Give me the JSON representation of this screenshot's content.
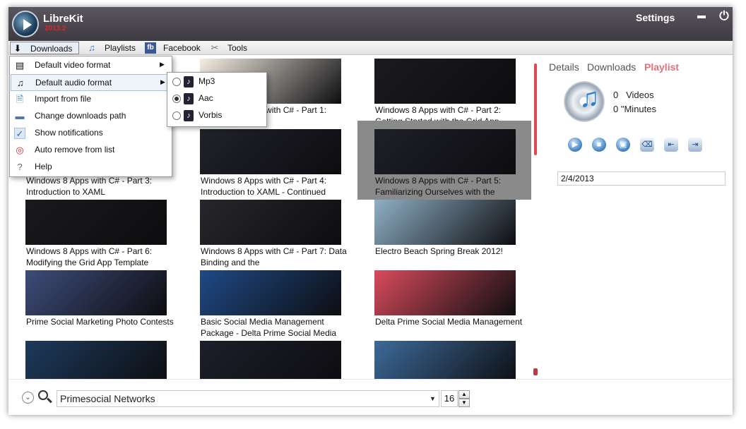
{
  "app": {
    "title": "LibreKit",
    "version": "2013.2"
  },
  "header": {
    "settings_label": "Settings",
    "minimize_icon": "minimize-icon",
    "power_icon": "power-icon"
  },
  "menubar": {
    "items": [
      {
        "label": "Downloads",
        "icon": "download-arrow-icon"
      },
      {
        "label": "Playlists",
        "icon": "music-note-icon"
      },
      {
        "label": "Facebook",
        "icon": "facebook-icon"
      },
      {
        "label": "Tools",
        "icon": "tools-icon"
      }
    ]
  },
  "downloads_menu": {
    "items": [
      {
        "label": "Default video format",
        "icon": "film-icon",
        "has_submenu": true
      },
      {
        "label": "Default audio format",
        "icon": "music-note-icon",
        "has_submenu": true
      },
      {
        "label": "Import from file",
        "icon": "file-import-icon"
      },
      {
        "label": "Change downloads path",
        "icon": "folder-icon"
      },
      {
        "label": "Show notifications",
        "icon": "checkmark-icon",
        "checked": true
      },
      {
        "label": "Auto remove from list",
        "icon": "lifebuoy-icon"
      },
      {
        "label": "Help",
        "icon": "help-icon"
      }
    ],
    "audio_submenu": [
      {
        "label": "Mp3",
        "selected": false
      },
      {
        "label": "Aac",
        "selected": true
      },
      {
        "label": "Vorbis",
        "selected": false
      }
    ]
  },
  "videos": [
    {
      "title": "",
      "thumb_color": "#e8d9c4"
    },
    {
      "title": "Windows 8 Apps with C# - Part 1: Introduction",
      "thumb_color": "#f4ede2"
    },
    {
      "title": "Windows 8 Apps with C# - Part 2: Getting Started with the Grid App",
      "thumb_color": "#1b1b1f"
    },
    {
      "title": "Windows 8 Apps with C# - Part 3: Introduction to XAML",
      "thumb_color": "#2b2d33"
    },
    {
      "title": "Windows 8 Apps with C# - Part 4: Introduction to XAML - Continued",
      "thumb_color": "#20222a"
    },
    {
      "title": "Windows 8 Apps with C# - Part 5: Familiarizing Ourselves with the",
      "thumb_color": "#1e2028"
    },
    {
      "title": "Windows 8 Apps with C# - Part 6: Modifying the Grid App Template",
      "thumb_color": "#1a1a1e"
    },
    {
      "title": "Windows 8 Apps with C# - Part 7: Data Binding and the",
      "thumb_color": "#26272c"
    },
    {
      "title": "Electro Beach Spring Break 2012!",
      "thumb_color": "#8fb0c6"
    },
    {
      "title": "Prime Social Marketing Photo Contests",
      "thumb_color": "#3d4c7a"
    },
    {
      "title": "Basic Social Media Management Package - Delta Prime Social Media",
      "thumb_color": "#1f4a86"
    },
    {
      "title": "Delta Prime Social Media Management",
      "thumb_color": "#d94b5c"
    },
    {
      "title": "",
      "thumb_color": "#1d3a5c"
    },
    {
      "title": "",
      "thumb_color": "#1c1f2a"
    },
    {
      "title": "",
      "thumb_color": "#3c6a9a"
    }
  ],
  "right_panel": {
    "tabs": [
      {
        "label": "Details",
        "active": false
      },
      {
        "label": "Downloads",
        "active": false
      },
      {
        "label": "Playlist",
        "active": true
      }
    ],
    "videos_count": "0",
    "videos_label": "Videos",
    "minutes_count": "0",
    "minutes_label": "\"Minutes",
    "controls": [
      "play-icon",
      "stop-icon",
      "save-icon",
      "eraser-icon",
      "move-left-icon",
      "move-right-icon"
    ],
    "date_value": "2/4/2013"
  },
  "search": {
    "value": "Primesocial Networks",
    "count": "16"
  },
  "colors": {
    "accent": "#e0727a",
    "titlebar": "#4a454d",
    "version": "#e0232b"
  }
}
